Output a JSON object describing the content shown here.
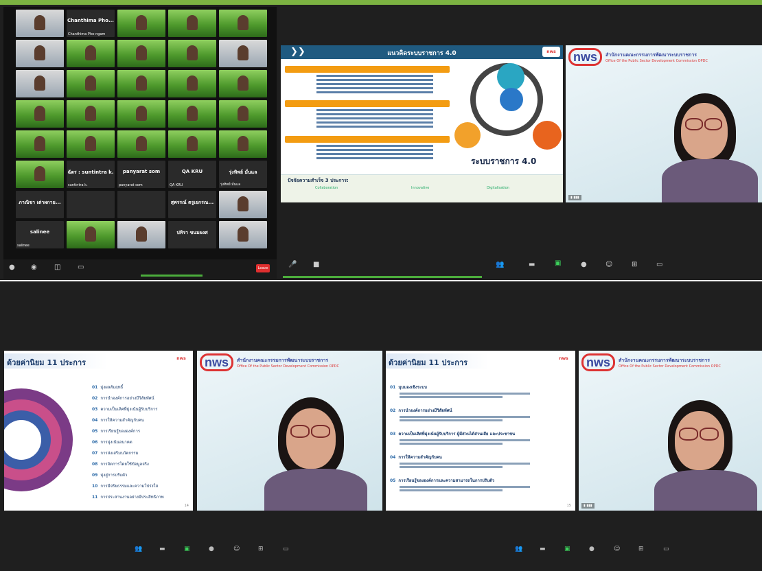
{
  "gallery": {
    "tiles": [
      {
        "name": "",
        "type": "room"
      },
      {
        "name": "Chanthima Pho...",
        "type": "dark",
        "sub": "Chanthima Pho-ngam"
      },
      {
        "name": "",
        "type": "green"
      },
      {
        "name": "",
        "type": "green"
      },
      {
        "name": "",
        "type": "green"
      },
      {
        "name": "",
        "type": "room"
      },
      {
        "name": "",
        "type": "green"
      },
      {
        "name": "",
        "type": "green"
      },
      {
        "name": "",
        "type": "green"
      },
      {
        "name": "",
        "type": "room"
      },
      {
        "name": "",
        "type": "room"
      },
      {
        "name": "",
        "type": "green"
      },
      {
        "name": "",
        "type": "green"
      },
      {
        "name": "",
        "type": "green"
      },
      {
        "name": "",
        "type": "green"
      },
      {
        "name": "",
        "type": "green"
      },
      {
        "name": "",
        "type": "green"
      },
      {
        "name": "",
        "type": "green"
      },
      {
        "name": "",
        "type": "green"
      },
      {
        "name": "",
        "type": "green"
      },
      {
        "name": "",
        "type": "green"
      },
      {
        "name": "",
        "type": "green"
      },
      {
        "name": "",
        "type": "green"
      },
      {
        "name": "",
        "type": "green"
      },
      {
        "name": "",
        "type": "green"
      },
      {
        "name": "",
        "type": "green"
      },
      {
        "name": "ฉัตร : suntintra k.",
        "type": "dark",
        "sub": "suntintra k."
      },
      {
        "name": "panyarat som",
        "type": "dark",
        "sub": "panyarat som"
      },
      {
        "name": "QA KRU",
        "type": "dark",
        "sub": "QA KRU"
      },
      {
        "name": "รุ่งทิพย์ มั่นแล",
        "type": "dark",
        "sub": "รุ่งทิพย์ มั่นแล"
      },
      {
        "name": "ภาณิชา เต่าผกาย...",
        "type": "dark",
        "sub": ""
      },
      {
        "name": "",
        "type": "dark"
      },
      {
        "name": "",
        "type": "dark"
      },
      {
        "name": "สุพรรณ์ ตรูเยกรณ...",
        "type": "dark",
        "sub": ""
      },
      {
        "name": "",
        "type": "room"
      },
      {
        "name": "salinee",
        "type": "dark",
        "sub": "salinee"
      },
      {
        "name": "",
        "type": "green"
      },
      {
        "name": "",
        "type": "room"
      },
      {
        "name": "ปทิรา ขนมผงศ",
        "type": "dark",
        "sub": ""
      },
      {
        "name": "",
        "type": "room"
      }
    ],
    "leave_label": "Leave",
    "controls": [
      "Mute",
      "Stop Video",
      "Participants",
      "Chat",
      "Share Screen",
      "Record",
      "Reactions",
      "Apps",
      "Whiteboards"
    ]
  },
  "slide_main": {
    "title": "แนวคิดระบบราชการ 4.0",
    "system_label": "ระบบราชการ 4.0",
    "bottom_title": "ปัจจัยความสำเร็จ 3 ประการ:",
    "factors": [
      "Collaboration",
      "Innovative",
      "Digitalisation"
    ]
  },
  "opdc": {
    "logo": "nws",
    "th": "สำนักงานคณะกรรมการพัฒนาระบบราชการ",
    "en": "Office Of the Public Sector Development Commission  OPDC"
  },
  "slide_11": {
    "title": "ด้วยค่านิยม 11 ประการ",
    "items": [
      {
        "num": "01",
        "text": "มุ่งผลสัมฤทธิ์"
      },
      {
        "num": "02",
        "text": "การนำองค์การอย่างมีวิสัยทัศน์"
      },
      {
        "num": "03",
        "text": "ความเป็นเลิศที่มุ่งเน้นผู้รับบริการ"
      },
      {
        "num": "04",
        "text": "การให้ความสำคัญกับคน"
      },
      {
        "num": "05",
        "text": "การเรียนรู้ขององค์การ"
      },
      {
        "num": "06",
        "text": "การมุ่งเน้นอนาคต"
      },
      {
        "num": "07",
        "text": "การส่งเสริมนวัตกรรม"
      },
      {
        "num": "08",
        "text": "การจัดการโดยใช้ข้อมูลจริง"
      },
      {
        "num": "09",
        "text": "มุ่งสู่การปรับตัว"
      },
      {
        "num": "10",
        "text": "การมีจริยธรรมและความโปร่งใส"
      },
      {
        "num": "11",
        "text": "การประสานงานอย่างมีประสิทธิภาพ"
      }
    ],
    "page": "14"
  },
  "slide_11b": {
    "title": "ด้วยค่านิยม 11 ประการ",
    "items": [
      {
        "num": "01",
        "text": "มุมมองเชิงระบบ"
      },
      {
        "num": "02",
        "text": "การนำองค์การอย่างมีวิสัยทัศน์"
      },
      {
        "num": "03",
        "text": "ความเป็นเลิศที่มุ่งเน้นผู้รับบริการ ผู้มีส่วนได้ส่วนเสีย และประชาชน"
      },
      {
        "num": "04",
        "text": "การให้ความสำคัญกับคน"
      },
      {
        "num": "05",
        "text": "การเรียนรู้ขององค์การและความสามารถในการปรับตัว"
      }
    ],
    "page": "15"
  }
}
